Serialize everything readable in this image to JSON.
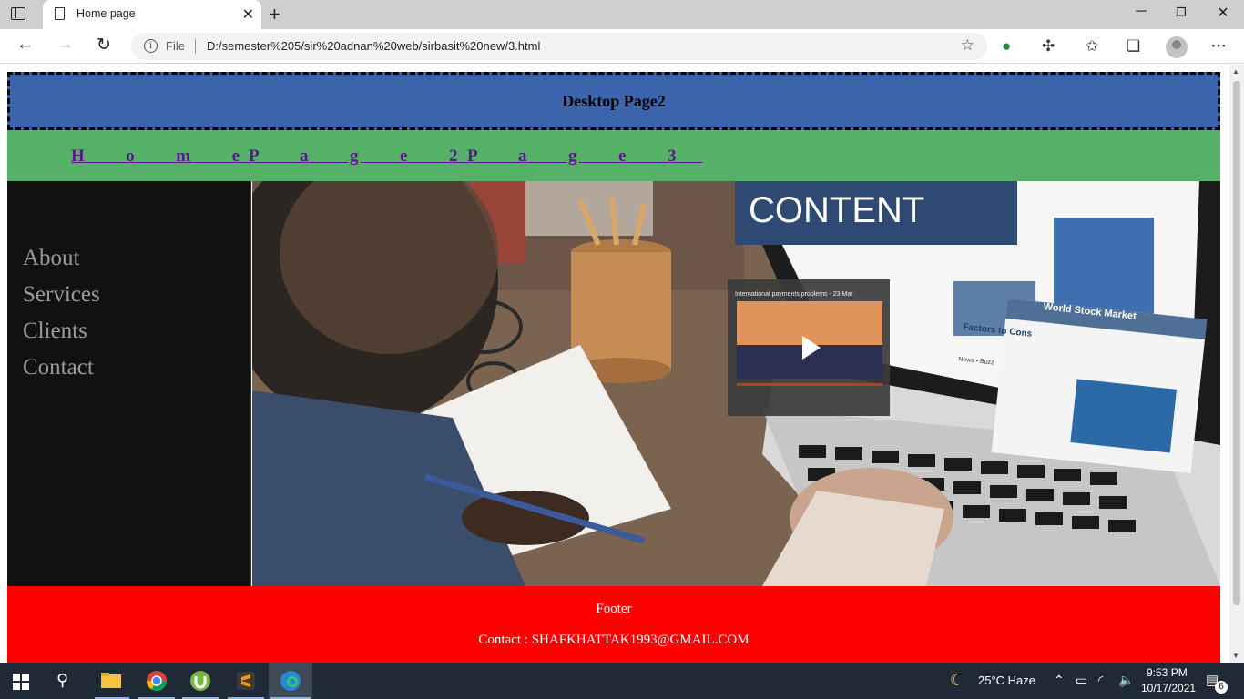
{
  "browser": {
    "tab_title": "Home page",
    "url_scheme_label": "File",
    "url": "D:/semester%205/sir%20adnan%20web/sirbasit%20new/3.html"
  },
  "page": {
    "header_title": "Desktop Page2",
    "menu": [
      {
        "label": "H  o  m  e "
      },
      {
        "label": "P  a  g  e  2 "
      },
      {
        "label": "P  a  g  e  3 "
      }
    ],
    "sidebar": [
      "About",
      "Services",
      "Clients",
      "Contact"
    ],
    "hero": {
      "screen_heading": "CONTENT",
      "popup_title": "World Stock Market",
      "video_title": "International payments problems - 23 Mar",
      "article_heading": "Factors to Cons",
      "news_label": "News • Buzz"
    },
    "footer_title": "Footer",
    "footer_contact": "Contact : SHAFKHATTAK1993@GMAIL.COM"
  },
  "taskbar": {
    "weather": "25°C  Haze",
    "time": "9:53 PM",
    "date": "10/17/2021",
    "notifications": "6"
  },
  "colors": {
    "header_bg": "#3b64ac",
    "menu_bg": "#55b167",
    "sidebar_bg": "#111111",
    "footer_bg": "#ff0000",
    "link": "#551a8b"
  }
}
